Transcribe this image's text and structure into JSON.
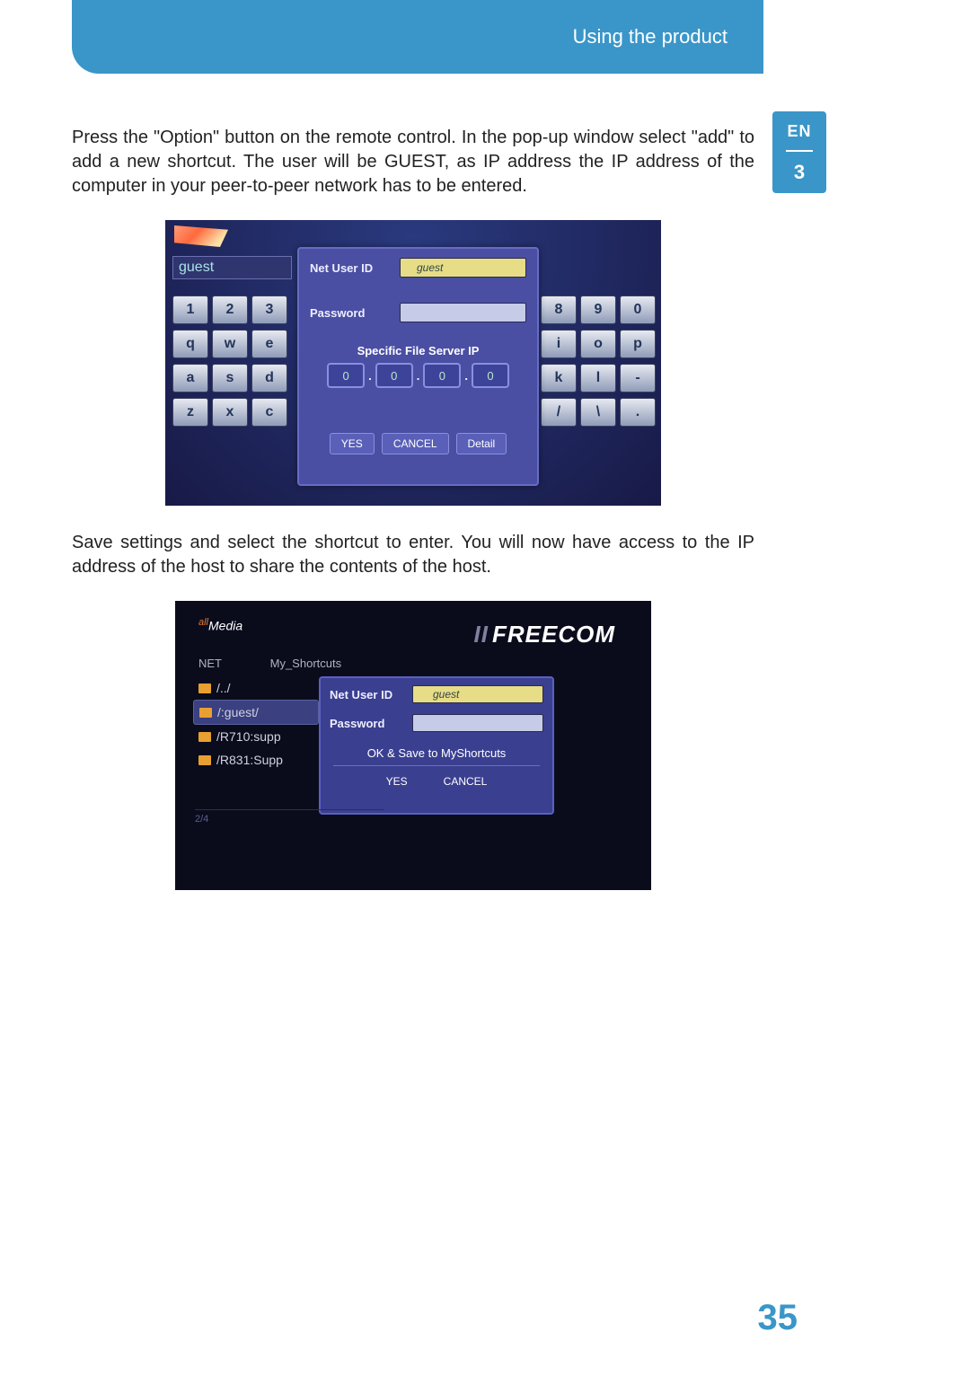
{
  "header": {
    "title": "Using the product"
  },
  "side": {
    "lang": "EN",
    "chap": "3"
  },
  "para1": "Press the \"Option\" button on the remote control. In the pop-up window select \"add\" to add a new shortcut. The user will be GUEST, as IP address the IP address of the computer in your peer-to-peer network has to be entered.",
  "para2": "Save settings and select the shortcut to enter. You will now have access to the IP address of the host to share the contents of the host.",
  "page_number": "35",
  "shot1": {
    "guest_header": "guest",
    "left_keys": [
      [
        "1",
        "2",
        "3"
      ],
      [
        "q",
        "w",
        "e"
      ],
      [
        "a",
        "s",
        "d"
      ],
      [
        "z",
        "x",
        "c"
      ]
    ],
    "right_keys": [
      [
        "8",
        "9",
        "0"
      ],
      [
        "i",
        "o",
        "p"
      ],
      [
        "k",
        "l",
        "-"
      ],
      [
        "/",
        "\\",
        "."
      ]
    ],
    "net_user_id_label": "Net User ID",
    "net_user_id_value": "guest",
    "password_label": "Password",
    "password_value": "",
    "sfip_label": "Specific File Server IP",
    "ip": [
      "0",
      "0",
      "0",
      "0"
    ],
    "yes": "YES",
    "cancel": "CANCEL",
    "detail": "Detail"
  },
  "shot2": {
    "media_logo": "Media",
    "media_all": "all",
    "freecom": "FREECOM",
    "breadcrumb_net": "NET",
    "breadcrumb_path": "My_Shortcuts",
    "items": [
      "/../",
      "/:guest/",
      "/R710:supp",
      "/R831:Supp"
    ],
    "selected_index": 1,
    "net_user_id_label": "Net User ID",
    "net_user_id_value": "guest",
    "password_label": "Password",
    "password_value": "",
    "save_label": "OK & Save to MyShortcuts",
    "yes": "YES",
    "cancel": "CANCEL",
    "counter": "2/4"
  }
}
